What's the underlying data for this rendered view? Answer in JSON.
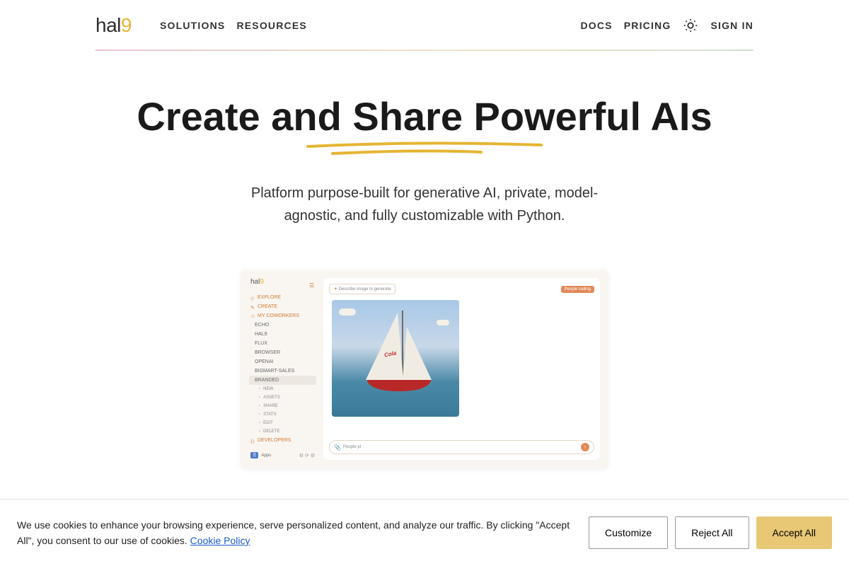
{
  "logo": {
    "hal": "hal",
    "nine": "9"
  },
  "nav": {
    "solutions": "SOLUTIONS",
    "resources": "RESOURCES",
    "docs": "DOCS",
    "pricing": "PRICING",
    "signin": "SIGN IN"
  },
  "hero": {
    "title": "Create and Share Powerful AIs",
    "subtitle": "Platform purpose-built for generative AI, private, model-agnostic, and fully customizable with Python."
  },
  "screenshot": {
    "logo_hal": "hal",
    "logo_nine": "9",
    "hamburger": "☰",
    "nav": {
      "explore": "EXPLORE",
      "create": "CREATE",
      "my_coworkers": "MY COWORKERS"
    },
    "coworkers": [
      "ECHO",
      "HAL9",
      "FLUX",
      "BROWSER",
      "OPENAI",
      "BIGMART-SALES",
      "BRANDED"
    ],
    "branded_sub": [
      "NEW",
      "ASSETS",
      "SHARE",
      "STATS",
      "EDIT",
      "DELETE"
    ],
    "developers": "DEVELOPERS",
    "apps": "Apps",
    "prompt_sparkle": "✦",
    "prompt_label": "Describe image to generate",
    "tag": "People sailing",
    "sail_brand": "Cola",
    "clip": "📎",
    "input_text": "People pl",
    "send": "↑"
  },
  "cookie": {
    "text_pre": "We use cookies to enhance your browsing experience, serve personalized  content, and analyze our traffic. By clicking \"Accept All\", you consent to our use of cookies. ",
    "link": "Cookie Policy",
    "customize": "Customize",
    "reject": "Reject All",
    "accept": "Accept All"
  },
  "colors": {
    "accent": "#e5b532",
    "accent2": "#d07830"
  }
}
